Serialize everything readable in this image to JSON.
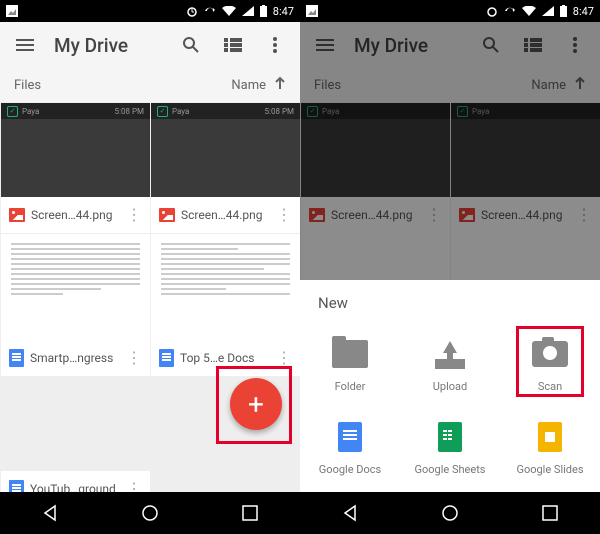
{
  "status": {
    "time": "8:47"
  },
  "appbar": {
    "title": "My Drive"
  },
  "subheader": {
    "left": "Files",
    "sort": "Name"
  },
  "files": [
    {
      "name": "Screen…44.png",
      "type": "image",
      "cap": "Paya",
      "time": "5:08 PM"
    },
    {
      "name": "Screen…44.png",
      "type": "image",
      "cap": "Paya",
      "time": "5:08 PM"
    },
    {
      "name": "Smartp…ngress",
      "type": "doc"
    },
    {
      "name": "Top 5…e Docs",
      "type": "doc"
    },
    {
      "name": "YouTub…ground",
      "type": "doc"
    }
  ],
  "sheet": {
    "title": "New",
    "items": [
      {
        "label": "Folder",
        "icon": "folder"
      },
      {
        "label": "Upload",
        "icon": "upload"
      },
      {
        "label": "Scan",
        "icon": "camera",
        "highlighted": true
      },
      {
        "label": "Google Docs",
        "icon": "gdoc-blue"
      },
      {
        "label": "Google Sheets",
        "icon": "gdoc-green"
      },
      {
        "label": "Google Slides",
        "icon": "gdoc-yellow"
      }
    ]
  }
}
